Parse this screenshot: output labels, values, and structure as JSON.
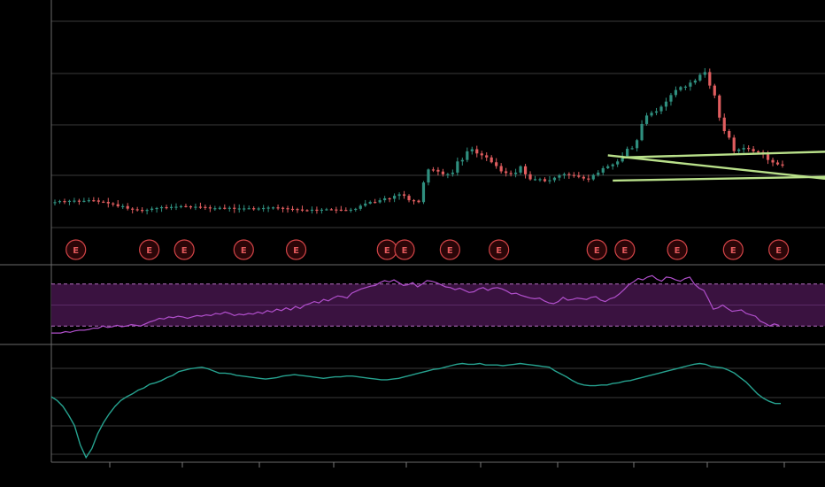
{
  "chart_data": [
    {
      "type": "candlestick",
      "panel": "price",
      "ylim": [
        0,
        100
      ],
      "x_count": 140,
      "up_color": "#2f8f7f",
      "down_color": "#e05d5f",
      "closes": [
        12.5,
        13,
        12.8,
        13.1,
        13.2,
        12.9,
        13.1,
        13.4,
        13.3,
        12.7,
        12.6,
        11.9,
        11.5,
        10.5,
        10.6,
        9.4,
        9.1,
        8.8,
        8.3,
        8.8,
        9.4,
        9.7,
        10.1,
        9.8,
        10.2,
        10.3,
        10.6,
        10.5,
        10.2,
        10.3,
        10.2,
        10,
        9.5,
        9.6,
        9.8,
        9.6,
        9.8,
        9.3,
        9.5,
        9.5,
        9.6,
        9.4,
        9.5,
        9.7,
        9.9,
        10,
        9.8,
        9.6,
        9.3,
        9.2,
        9,
        8.7,
        8.6,
        8.9,
        8.8,
        8.9,
        9.1,
        9,
        8.9,
        8.8,
        8.7,
        8.9,
        9.3,
        10.8,
        11.8,
        12.6,
        12.4,
        13.4,
        14.3,
        14.1,
        15.5,
        16.2,
        15.5,
        13.4,
        13.2,
        12.5,
        21.8,
        28,
        27.8,
        27,
        25.7,
        25.8,
        26.5,
        31.8,
        32.5,
        36.6,
        37.6,
        35.6,
        34.7,
        33.7,
        31.4,
        29.6,
        27.1,
        26.3,
        25.8,
        26.5,
        29.5,
        25.7,
        23.3,
        23.4,
        23.4,
        22.4,
        22.9,
        24.1,
        25.2,
        25.8,
        25.4,
        25.1,
        24.5,
        23.7,
        23.3,
        25.4,
        26.5,
        28.6,
        29.5,
        30.4,
        31.8,
        34.3,
        37.8,
        38.1,
        41.9,
        49.6,
        53.6,
        54.9,
        55.6,
        57.8,
        60.2,
        63.3,
        65.7,
        67.1,
        67.3,
        69.2,
        70.2,
        72.9,
        74.2,
        67.8,
        63.1,
        52.6,
        46.2,
        43.1,
        36.7,
        37.5,
        38.2,
        37.7,
        36.6,
        36.2,
        35.2,
        32.5,
        31.3,
        30.4,
        29.8
      ],
      "earnings_markers": {
        "label": "E",
        "indices": [
          6,
          27,
          37,
          54,
          69,
          95,
          100,
          113,
          127,
          155,
          163,
          178,
          194,
          207
        ]
      },
      "support_resistance_levels": [
        {
          "from_index": 117,
          "value_start": 33.7,
          "value_end": 36.4
        },
        {
          "from_index": 114,
          "value_start": 34.7,
          "value_end": 23.6
        },
        {
          "from_index": 115,
          "value_start": 22.7,
          "value_end": 24.5
        }
      ]
    },
    {
      "type": "line",
      "panel": "rsi",
      "ylim": [
        0,
        100
      ],
      "guides": [
        80,
        20
      ],
      "midline": 50,
      "values": [
        10,
        10,
        10,
        12,
        11,
        13,
        14,
        14,
        15,
        17,
        17,
        20,
        18,
        19,
        21,
        19,
        20,
        22,
        21,
        20,
        23,
        26,
        28,
        31,
        30,
        33,
        32,
        34,
        33,
        31,
        33,
        35,
        34,
        36,
        35,
        38,
        37,
        40,
        38,
        35,
        37,
        36,
        38,
        37,
        40,
        38,
        42,
        40,
        44,
        42,
        46,
        43,
        48,
        45,
        50,
        52,
        55,
        53,
        58,
        56,
        60,
        63,
        62,
        60,
        67,
        70,
        73,
        75,
        77,
        78,
        82,
        85,
        83,
        86,
        82,
        78,
        79,
        82,
        76,
        80,
        85,
        84,
        82,
        79,
        76,
        75,
        72,
        74,
        71,
        68,
        69,
        73,
        75,
        71,
        74,
        75,
        73,
        70,
        66,
        67,
        64,
        62,
        60,
        59,
        60,
        56,
        53,
        52,
        55,
        61,
        57,
        58,
        60,
        59,
        58,
        61,
        62,
        57,
        55,
        59,
        61,
        66,
        72,
        79,
        83,
        88,
        86,
        90,
        92,
        87,
        84,
        90,
        89,
        86,
        84,
        88,
        90,
        80,
        74,
        71,
        58,
        44,
        46,
        50,
        45,
        41,
        42,
        43,
        38,
        36,
        34,
        27,
        24,
        20,
        23,
        21
      ]
    },
    {
      "type": "line",
      "panel": "oscillator",
      "ylim": [
        -100,
        40
      ],
      "values": [
        -20,
        -25,
        -33,
        -45,
        -59,
        -85,
        -102,
        -90,
        -70,
        -55,
        -43,
        -33,
        -25,
        -20,
        -16,
        -11,
        -8,
        -3,
        -1,
        2,
        6,
        9,
        14,
        16,
        18,
        19,
        20,
        18,
        15,
        12,
        12,
        11,
        9,
        8,
        7,
        6,
        5,
        4,
        5,
        6,
        8,
        9,
        10,
        9,
        8,
        7,
        6,
        5,
        6,
        7,
        7,
        8,
        8,
        7,
        6,
        5,
        4,
        3,
        3,
        4,
        5,
        7,
        9,
        11,
        13,
        15,
        17,
        18,
        20,
        22,
        24,
        25,
        24,
        24,
        25,
        23,
        23,
        23,
        22,
        23,
        24,
        25,
        24,
        23,
        22,
        21,
        20,
        15,
        11,
        7,
        2,
        -2,
        -4,
        -5,
        -5,
        -4,
        -4,
        -2,
        -1,
        1,
        2,
        4,
        6,
        8,
        10,
        12,
        14,
        16,
        18,
        20,
        22,
        24,
        25,
        24,
        21,
        20,
        19,
        16,
        12,
        6,
        0,
        -8,
        -16,
        -22,
        -26,
        -29,
        -29
      ],
      "step": 5.5,
      "ends_at_x": 882
    }
  ]
}
